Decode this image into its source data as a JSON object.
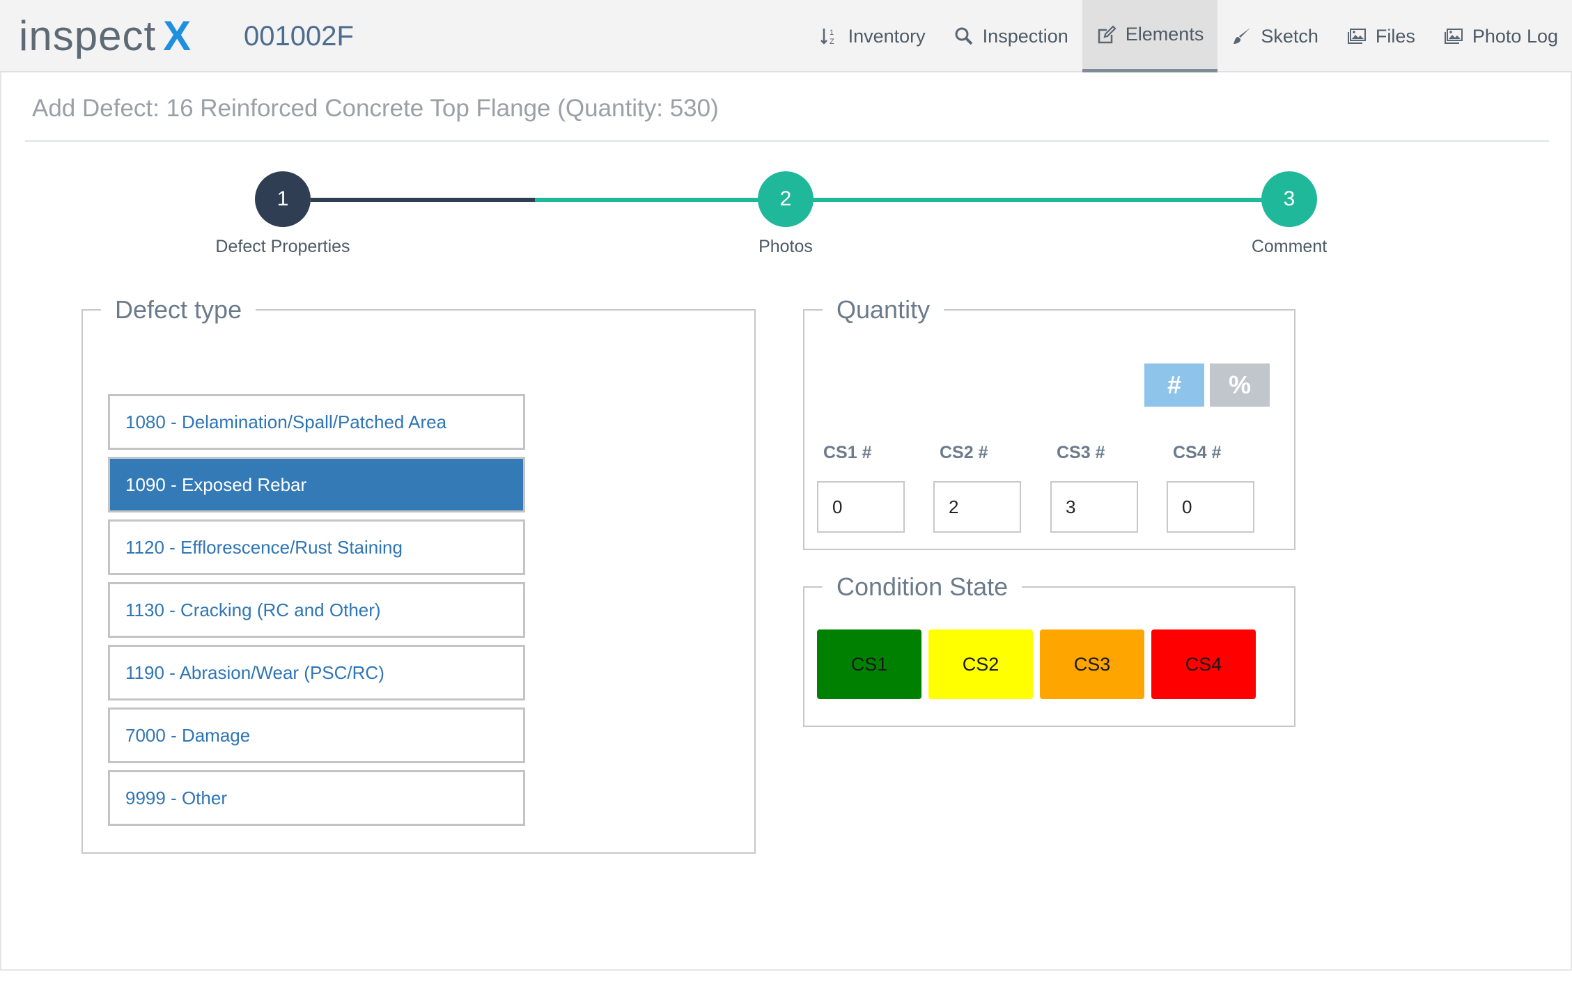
{
  "app": {
    "logo_text": "inspect",
    "logo_x": "X",
    "structure_id": "001002F"
  },
  "nav": [
    {
      "label": "Inventory",
      "icon": "sort-icon"
    },
    {
      "label": "Inspection",
      "icon": "search-icon"
    },
    {
      "label": "Elements",
      "icon": "edit-icon",
      "active": true
    },
    {
      "label": "Sketch",
      "icon": "brush-icon"
    },
    {
      "label": "Files",
      "icon": "image-icon"
    },
    {
      "label": "Photo Log",
      "icon": "image-icon"
    }
  ],
  "page_title": "Add Defect: 16 Reinforced Concrete Top Flange (Quantity: 530)",
  "steps": [
    {
      "number": "1",
      "label": "Defect Properties",
      "state": "current"
    },
    {
      "number": "2",
      "label": "Photos",
      "state": "upcoming"
    },
    {
      "number": "3",
      "label": "Comment",
      "state": "upcoming"
    }
  ],
  "defect_type": {
    "legend": "Defect type",
    "items": [
      {
        "label": "1080 - Delamination/Spall/Patched Area"
      },
      {
        "label": "1090 - Exposed Rebar",
        "selected": true
      },
      {
        "label": "1120 - Efflorescence/Rust Staining"
      },
      {
        "label": "1130 - Cracking (RC and Other)"
      },
      {
        "label": "1190 - Abrasion/Wear (PSC/RC)"
      },
      {
        "label": "7000 - Damage"
      },
      {
        "label": "9999 - Other"
      }
    ]
  },
  "quantity": {
    "legend": "Quantity",
    "toggle_count": "#",
    "toggle_percent": "%",
    "fields": [
      {
        "label": "CS1 #",
        "value": "0"
      },
      {
        "label": "CS2 #",
        "value": "2"
      },
      {
        "label": "CS3 #",
        "value": "3"
      },
      {
        "label": "CS4 #",
        "value": "0"
      }
    ]
  },
  "condition_state": {
    "legend": "Condition State",
    "buttons": [
      {
        "label": "CS1",
        "color": "#008000"
      },
      {
        "label": "CS2",
        "color": "#ffff00"
      },
      {
        "label": "CS3",
        "color": "#ffa500"
      },
      {
        "label": "CS4",
        "color": "#ff0000"
      }
    ]
  },
  "colors": {
    "step_current": "#2f3e52",
    "step_upcoming": "#1fb89a",
    "selected_item": "#337ab7",
    "toggle_active": "#8ec3ea",
    "toggle_inactive": "#c0c6cc"
  }
}
